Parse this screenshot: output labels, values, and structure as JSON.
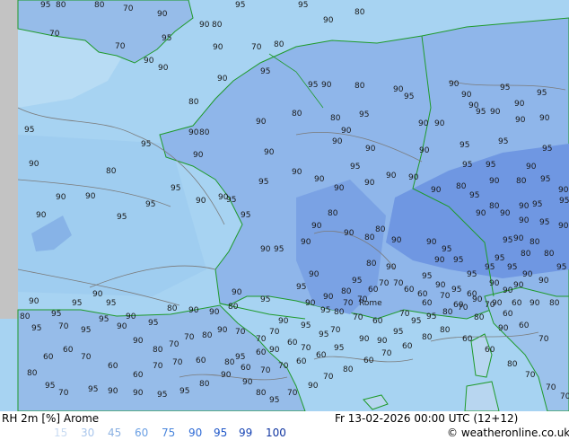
{
  "map": {
    "contour_labels": [
      "95",
      "80",
      "80",
      "90",
      "90",
      "80",
      "95",
      "95",
      "70",
      "90",
      "80",
      "70",
      "70",
      "95",
      "90",
      "70",
      "80",
      "90",
      "90",
      "90",
      "80",
      "95",
      "95",
      "90",
      "80",
      "80",
      "90",
      "80",
      "80",
      "90",
      "90",
      "90",
      "95",
      "95",
      "90",
      "90",
      "90",
      "90",
      "90",
      "90",
      "95",
      "90",
      "95",
      "95",
      "90",
      "90",
      "90",
      "95",
      "95",
      "90",
      "95",
      "95",
      "90",
      "95",
      "95",
      "80",
      "90",
      "90",
      "95",
      "95",
      "90",
      "95",
      "90",
      "90",
      "80",
      "90",
      "95",
      "90",
      "90",
      "80",
      "80",
      "90",
      "90",
      "90",
      "90",
      "95",
      "90",
      "90",
      "90",
      "90",
      "95",
      "95",
      "95",
      "90",
      "90",
      "95",
      "95",
      "95",
      "90",
      "90",
      "90",
      "90",
      "80",
      "90",
      "95",
      "95",
      "90",
      "90",
      "95",
      "90",
      "80",
      "90",
      "90",
      "80",
      "80",
      "90",
      "90",
      "95",
      "90",
      "95",
      "95",
      "95",
      "95",
      "95",
      "80",
      "80",
      "95",
      "90",
      "90",
      "95",
      "90",
      "95",
      "90",
      "80",
      "95",
      "80",
      "90",
      "90",
      "95",
      "95",
      "90",
      "80",
      "90",
      "90",
      "80",
      "95",
      "90",
      "95",
      "90",
      "95",
      "95",
      "90",
      "80",
      "95",
      "70",
      "95",
      "95",
      "90",
      "90",
      "80",
      "70",
      "70",
      "80",
      "90",
      "70",
      "70",
      "70",
      "60",
      "70",
      "90",
      "60",
      "95",
      "80",
      "60",
      "70",
      "70",
      "60",
      "60",
      "70",
      "60",
      "60",
      "80",
      "95",
      "70",
      "95",
      "90",
      "90",
      "95",
      "95",
      "80",
      "90",
      "90",
      "80",
      "95",
      "70",
      "90",
      "70",
      "80",
      "60",
      "70",
      "60",
      "80",
      "80",
      "60",
      "60",
      "80",
      "70",
      "70",
      "70",
      "70",
      "60",
      "60",
      "70",
      "60",
      "60",
      "70",
      "60",
      "70",
      "80",
      "95",
      "90",
      "90",
      "95",
      "95",
      "95",
      "90",
      "90",
      "95",
      "95",
      "95",
      "80",
      "70",
      "80",
      "90",
      "90",
      "80",
      "95",
      "90",
      "90",
      "90",
      "90",
      "60",
      "90",
      "60",
      "70",
      "60",
      "60",
      "70",
      "70",
      "60",
      "70",
      "70",
      "70",
      "60",
      "60",
      "70",
      "70",
      "60",
      "90",
      "95",
      "95",
      "90",
      "95",
      "95",
      "95",
      "95",
      "60",
      "70",
      "60",
      "70",
      "70",
      "70",
      "60",
      "70",
      "60",
      "70",
      "60",
      "70",
      "60",
      "70",
      "70",
      "60",
      "70",
      "70",
      "60",
      "60",
      "60",
      "70",
      "70",
      "70",
      "70",
      "70",
      "60"
    ],
    "city_label": "Rome"
  },
  "footer": {
    "title": "RH 2m [%] Arome",
    "datetime": "Fr 13-02-2026 00:00 UTC (12+12)",
    "credit": "© weatheronline.co.uk",
    "scale": [
      {
        "value": "15",
        "color": "#c8dbf2"
      },
      {
        "value": "30",
        "color": "#a9c6ec"
      },
      {
        "value": "45",
        "color": "#8bb1e2"
      },
      {
        "value": "60",
        "color": "#6ba0e4"
      },
      {
        "value": "75",
        "color": "#4a86dc"
      },
      {
        "value": "90",
        "color": "#2f6bd6"
      },
      {
        "value": "95",
        "color": "#1e56c8"
      },
      {
        "value": "99",
        "color": "#1744b4"
      },
      {
        "value": "100",
        "color": "#0f34a0"
      }
    ]
  },
  "colors": {
    "sea": "#a7d3f2",
    "land_low": "#b8d6f0",
    "land_mid": "#96bce9",
    "land_high": "#7aa2e4",
    "land_very_high": "#6690e0",
    "contour": "#7a7a7a",
    "coast": "#1e9a2a",
    "border_strip": "#c3c3c3"
  }
}
